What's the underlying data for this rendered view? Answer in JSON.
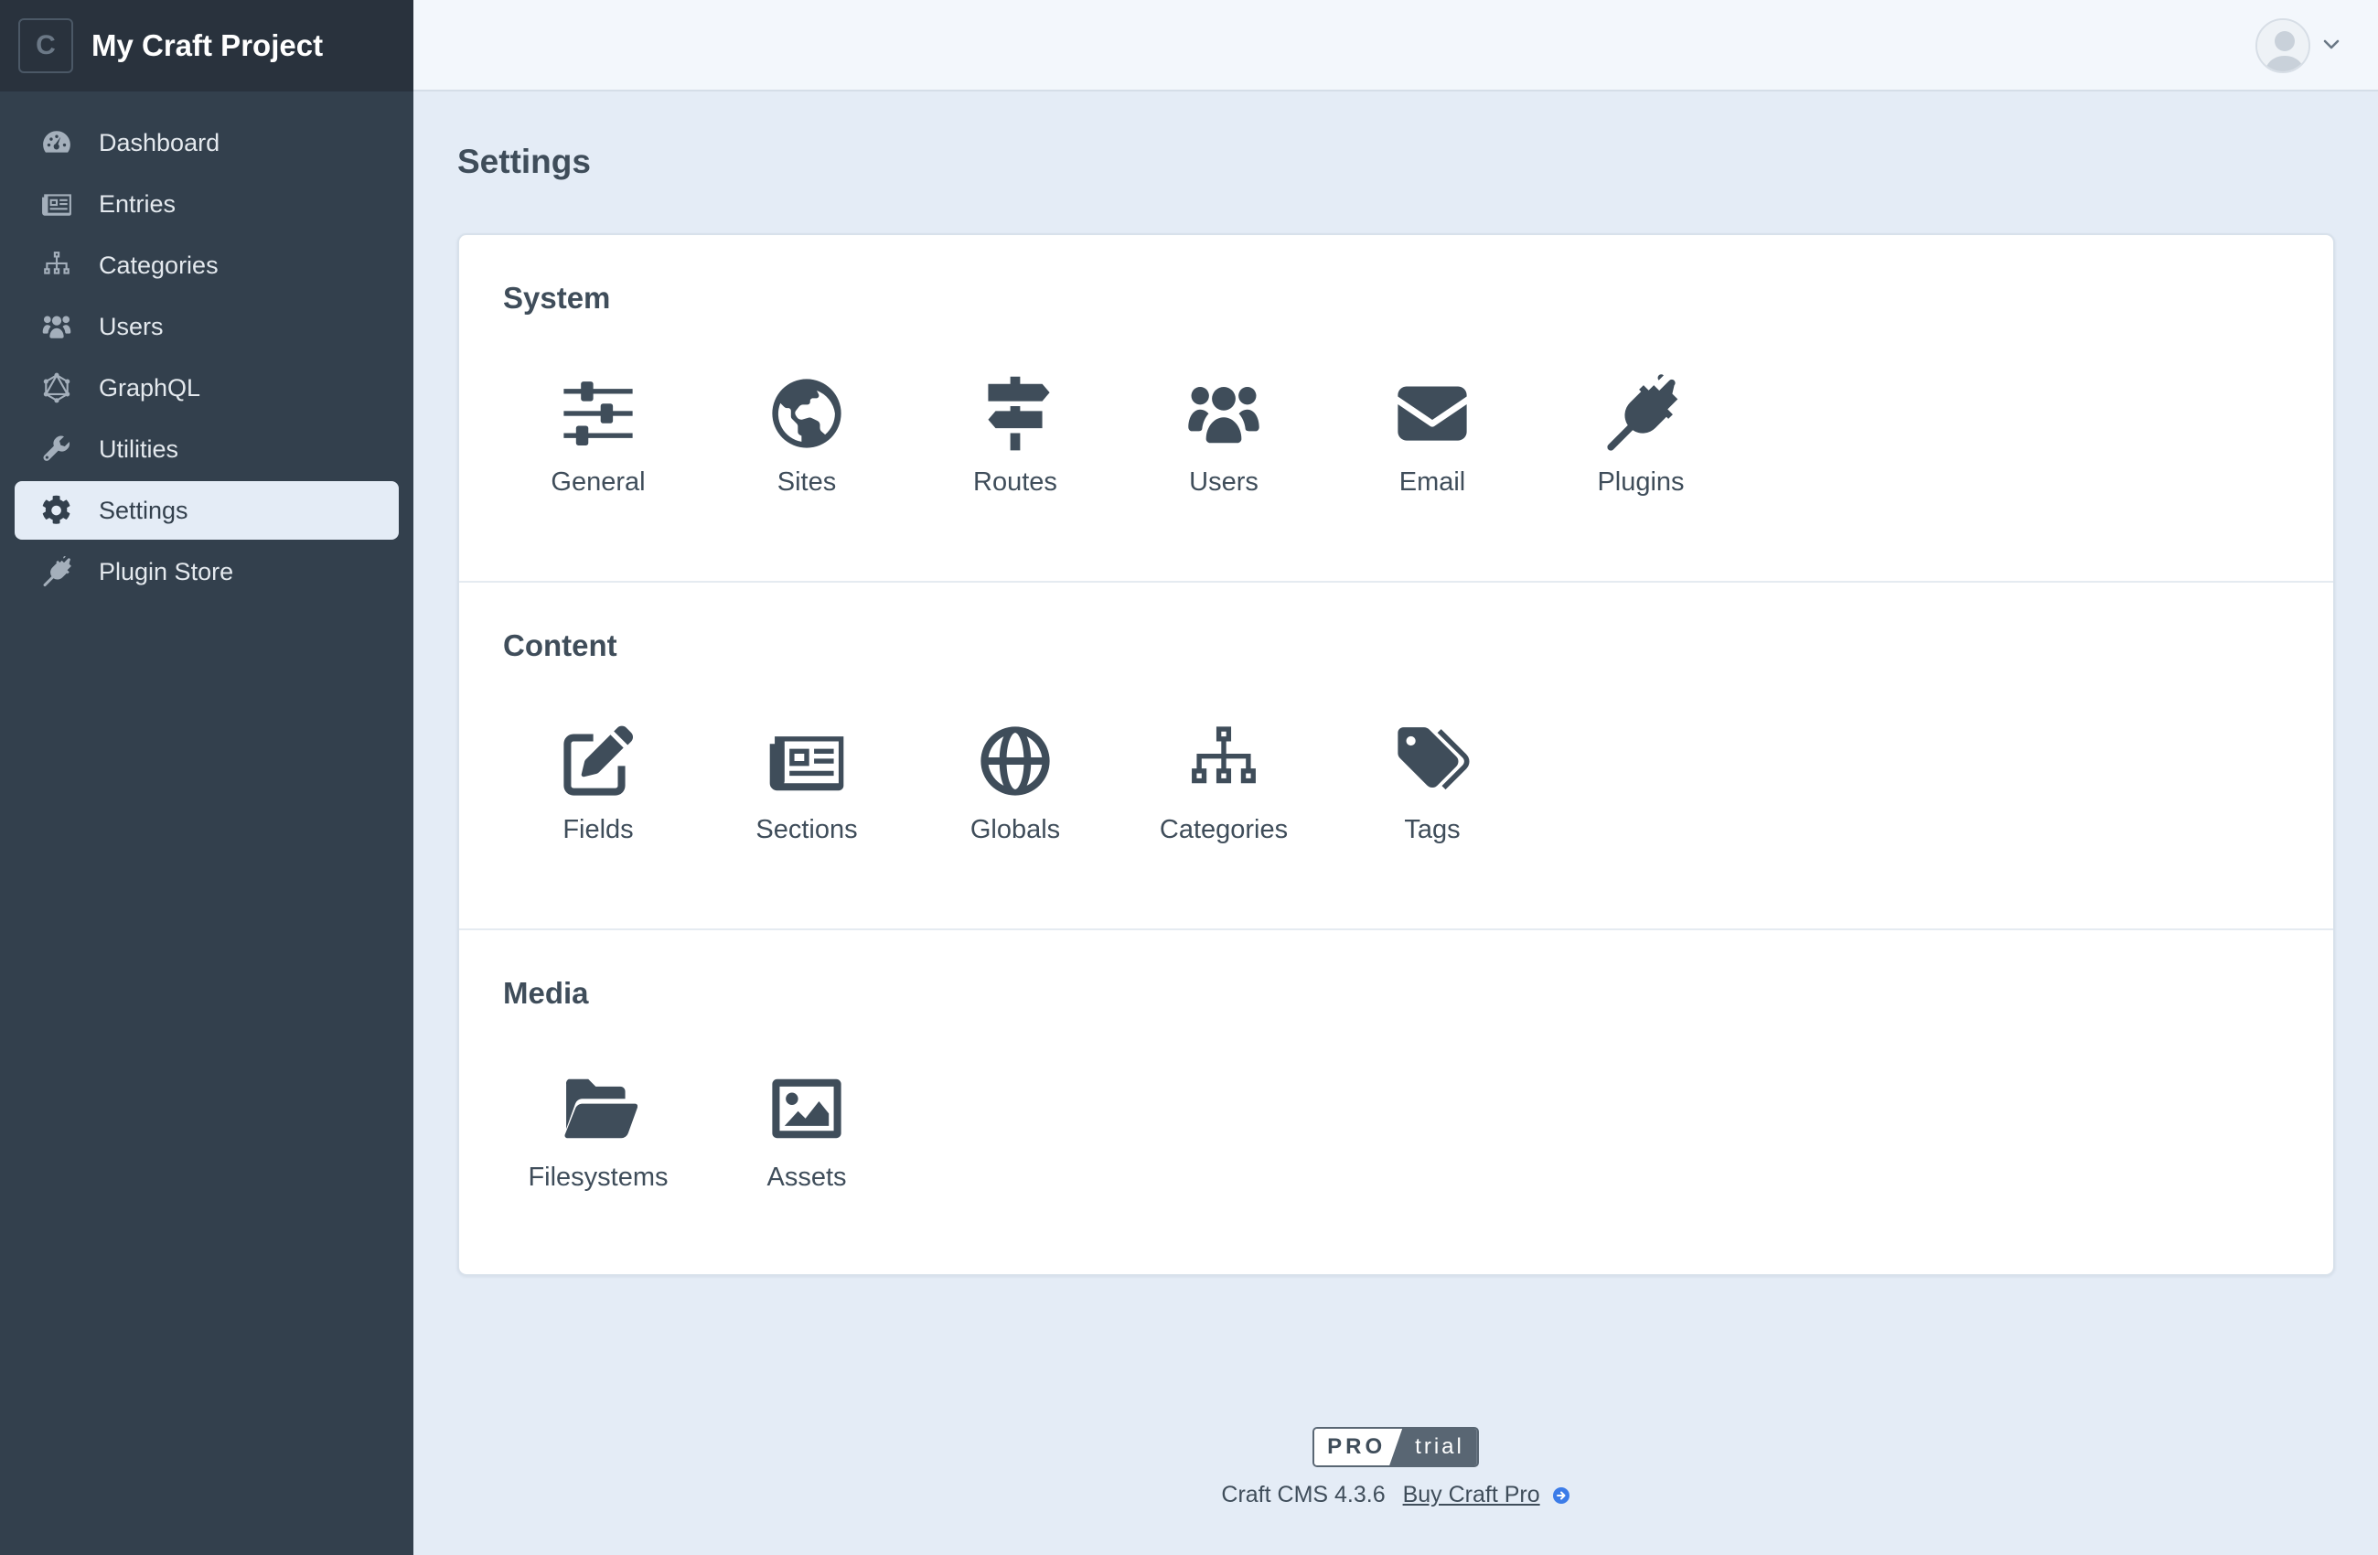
{
  "app": {
    "logo_letter": "C",
    "site_name": "My Craft Project"
  },
  "sidebar": {
    "items": [
      {
        "label": "Dashboard",
        "icon": "gauge-icon"
      },
      {
        "label": "Entries",
        "icon": "newspaper-icon"
      },
      {
        "label": "Categories",
        "icon": "sitemap-icon"
      },
      {
        "label": "Users",
        "icon": "users-icon"
      },
      {
        "label": "GraphQL",
        "icon": "graphql-icon"
      },
      {
        "label": "Utilities",
        "icon": "wrench-icon"
      },
      {
        "label": "Settings",
        "icon": "gear-icon",
        "active": true
      },
      {
        "label": "Plugin Store",
        "icon": "plug-icon"
      }
    ]
  },
  "header": {
    "account_icon": "user-avatar-icon"
  },
  "main": {
    "title": "Settings",
    "groups": [
      {
        "title": "System",
        "items": [
          {
            "label": "General",
            "icon": "sliders-icon"
          },
          {
            "label": "Sites",
            "icon": "globe-americas-icon"
          },
          {
            "label": "Routes",
            "icon": "signpost-icon"
          },
          {
            "label": "Users",
            "icon": "users-icon"
          },
          {
            "label": "Email",
            "icon": "envelope-icon"
          },
          {
            "label": "Plugins",
            "icon": "plug-icon"
          }
        ]
      },
      {
        "title": "Content",
        "items": [
          {
            "label": "Fields",
            "icon": "pen-to-square-icon"
          },
          {
            "label": "Sections",
            "icon": "newspaper-icon"
          },
          {
            "label": "Globals",
            "icon": "globe-icon"
          },
          {
            "label": "Categories",
            "icon": "sitemap-icon"
          },
          {
            "label": "Tags",
            "icon": "tags-icon"
          }
        ]
      },
      {
        "title": "Media",
        "items": [
          {
            "label": "Filesystems",
            "icon": "folder-open-icon"
          },
          {
            "label": "Assets",
            "icon": "image-icon"
          }
        ]
      }
    ]
  },
  "footer": {
    "edition_name": "PRO",
    "edition_status": "trial",
    "version_text": "Craft CMS 4.3.6",
    "buy_link": "Buy Craft Pro"
  },
  "colors": {
    "sidebar_bg": "#33404d",
    "content_bg": "#e4ecf6",
    "text": "#3f4d5a",
    "link_icon": "#3c7ce8"
  }
}
